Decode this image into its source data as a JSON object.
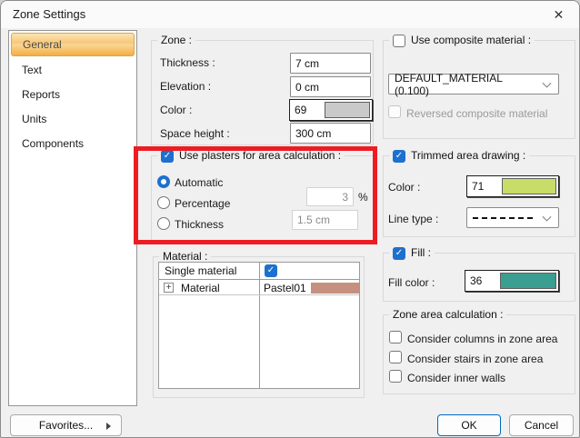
{
  "window": {
    "title": "Zone Settings"
  },
  "icons": {
    "close": "✕",
    "check": "✓",
    "expand": "+"
  },
  "sidebar": {
    "items": [
      {
        "label": "General",
        "selected": true
      },
      {
        "label": "Text"
      },
      {
        "label": "Reports"
      },
      {
        "label": "Units"
      },
      {
        "label": "Components"
      }
    ]
  },
  "zone": {
    "legend": "Zone :",
    "thickness_label": "Thickness :",
    "thickness_value": "7 cm",
    "elevation_label": "Elevation :",
    "elevation_value": "0 cm",
    "color_label": "Color :",
    "color_index": "69",
    "color_swatch": "#c9c9c9",
    "space_label": "Space height :",
    "space_value": "300 cm"
  },
  "plasters": {
    "legend": "Use plasters for area calculation :",
    "checked": true,
    "automatic_label": "Automatic",
    "percentage_label": "Percentage",
    "percentage_value": "3",
    "percentage_unit": "%",
    "thickness_label": "Thickness",
    "thickness_value": "1.5 cm"
  },
  "material": {
    "legend": "Material :",
    "header_label": "Single material",
    "row_label": "Material",
    "row_value": "Pastel01",
    "row_swatch": "#c5907f"
  },
  "composite": {
    "legend": "Use composite material :",
    "checked": false,
    "dropdown_value": "DEFAULT_MATERIAL (0.100)",
    "reversed_label": "Reversed composite material"
  },
  "trimmed": {
    "legend": "Trimmed area drawing :",
    "checked": true,
    "color_label": "Color :",
    "color_index": "71",
    "color_swatch": "#c8dd68",
    "line_type_label": "Line type :",
    "line_type_value": "dashed"
  },
  "fill": {
    "legend": "Fill :",
    "checked": true,
    "color_label": "Fill color :",
    "color_index": "36",
    "color_swatch": "#3a9e91"
  },
  "zone_area": {
    "legend": "Zone area calculation :",
    "options": [
      "Consider columns in zone area",
      "Consider stairs in zone area",
      "Consider inner walls"
    ]
  },
  "buttons": {
    "favorites": "Favorites...",
    "ok": "OK",
    "cancel": "Cancel"
  },
  "annotation": {
    "highlight_color": "#ed1c24"
  }
}
